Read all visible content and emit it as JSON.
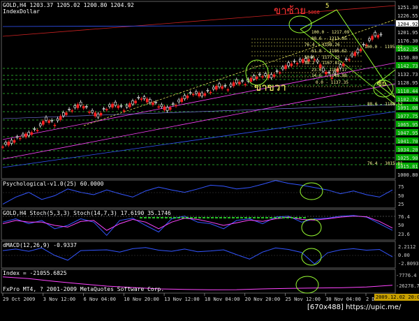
{
  "window": {
    "title": "GOLD,H4  1203.37 1205.02 1200.80 1204.92",
    "subtitle": "IndexDollar"
  },
  "annotations": {
    "thai_top": "ขาซ้าย",
    "thai_bottom": "ขาขวา",
    "wave_top": "5",
    "wave_mid": "ซ้ย",
    "level_5060": "5060",
    "watermark": "[670x488] https://upic.me/",
    "copyright": "FxPro MT4, ? 2001-2009 MetaQuotes Software Corp.",
    "time_stamp": "2009.12.02 20:00"
  },
  "fib_labels": [
    "100.0 - 1217.09",
    "88.6 - 1213.95",
    "76.4 - 1198.26",
    "61.8 - 1186.62",
    "50.0 - 1177.25",
    "38.2 - 1167.81",
    "23.6 - 1156.17",
    "14.6 - 1148.98",
    "0.0 - 1137.35",
    "100.0 - 1195.22",
    "88.6 - 1188.52",
    "76.4 - 1015.81"
  ],
  "price_axis": {
    "labels": [
      "1251.30",
      "1226.55",
      "1204.92",
      "1201.95",
      "1176.30",
      "1162.35",
      "1150.80",
      "1142.73",
      "1132.73",
      "1128.95",
      "1118.44",
      "1102.74",
      "1091.08",
      "1077.75",
      "1065.95",
      "1047.95",
      "1041.70",
      "1034.20",
      "1025.90",
      "1015.81",
      "1000.80"
    ],
    "highlight_labels": [
      "1162.35",
      "1142.73",
      "1118.44",
      "1102.74",
      "1091.08",
      "1077.75",
      "1065.95",
      "1047.95",
      "1041.70",
      "1034.20",
      "1025.90",
      "1015.81"
    ],
    "current_label": "1204.92"
  },
  "time_axis": {
    "labels": [
      "29 Oct 2009",
      "3 Nov 12:00",
      "6 Nov 04:00",
      "10 Nov 20:00",
      "13 Nov 12:00",
      "18 Nov 04:00",
      "20 Nov 20:00",
      "25 Nov 12:00",
      "30 Nov 04:00",
      "2 Dec 20:00"
    ]
  },
  "indicators": {
    "psychological": {
      "title": "Psychological-v1.0(25) 60.0000",
      "axis": [
        "75",
        "50",
        "25"
      ]
    },
    "stoch": {
      "title": "GOLD,H4 Stoch(5,3,3) Stoch(14,7,3) 17.6190 35.1746",
      "axis": [
        "76.4",
        "50",
        "23.6"
      ]
    },
    "macd": {
      "title": "dMACD(12,26,9) -0.9337",
      "axis": [
        "2.2112",
        "0.00",
        "-2.8093"
      ]
    },
    "index": {
      "title": "Index = -21055.6825",
      "axis": [
        "-7776.4",
        "-26278.7"
      ]
    }
  },
  "colors": {
    "background": "#000000",
    "bull": "#ffffff",
    "bear": "#ff2020",
    "fib": "#ffff66",
    "grid_green": "#33cc33",
    "channel": "#ff44ff",
    "blue_line": "#3355ff",
    "axis_box": "#00aa00"
  },
  "chart_data": [
    {
      "type": "line",
      "series": [
        {
          "x": [
            0,
            10,
            20,
            30,
            40,
            50,
            60,
            70,
            80,
            90,
            100,
            110,
            120,
            130,
            140,
            150,
            160,
            170,
            180,
            190,
            200,
            210,
            220,
            230,
            240,
            250,
            260,
            270,
            280,
            290,
            300,
            310,
            320,
            330,
            340,
            350,
            360,
            370,
            380,
            390,
            400,
            410,
            420,
            430,
            440
          ],
          "values": [
            1045,
            1050,
            1058,
            1062,
            1070,
            1085,
            1078,
            1092,
            1100,
            1108,
            1098,
            1090,
            1102,
            1108,
            1100,
            1110,
            1118,
            1112,
            1106,
            1100,
            1108,
            1118,
            1125,
            1122,
            1128,
            1136,
            1132,
            1142,
            1140,
            1148,
            1152,
            1150,
            1158,
            1168,
            1172,
            1175,
            1178,
            1160,
            1150,
            1165,
            1178,
            1188,
            1200,
            1214,
            1210
          ]
        }
      ],
      "ylim": [
        1000.8,
        1260
      ]
    },
    {
      "type": "line",
      "series": [
        {
          "x": [
            0,
            15,
            30,
            45,
            60,
            75,
            90,
            105,
            120,
            135,
            150,
            165,
            180,
            195,
            210,
            225,
            240,
            255,
            270,
            285,
            300,
            315,
            330,
            345,
            360,
            375,
            390,
            405,
            420,
            435,
            450
          ],
          "values": [
            30,
            45,
            55,
            40,
            48,
            62,
            55,
            50,
            60,
            52,
            45,
            58,
            66,
            60,
            55,
            62,
            70,
            68,
            62,
            65,
            72,
            80,
            74,
            70,
            65,
            60,
            52,
            58,
            50,
            45,
            60
          ]
        }
      ],
      "ylim": [
        25,
        75
      ]
    },
    {
      "type": "line",
      "series": [
        {
          "x": [
            0,
            15,
            30,
            45,
            60,
            75,
            90,
            105,
            120,
            135,
            150,
            165,
            180,
            195,
            210,
            225,
            240,
            255,
            270,
            285,
            300,
            315,
            330,
            345,
            360,
            375,
            390,
            405,
            420,
            435,
            450
          ],
          "values": [
            60,
            70,
            55,
            65,
            40,
            50,
            70,
            60,
            20,
            65,
            72,
            50,
            30,
            70,
            78,
            60,
            55,
            40,
            65,
            70,
            55,
            75,
            78,
            60,
            70,
            72,
            78,
            80,
            75,
            55,
            35
          ]
        },
        {
          "x": [
            0,
            15,
            30,
            45,
            60,
            75,
            90,
            105,
            120,
            135,
            150,
            165,
            180,
            195,
            210,
            225,
            240,
            255,
            270,
            285,
            300,
            315,
            330,
            345,
            360,
            375,
            390,
            405,
            420,
            435,
            450
          ],
          "values": [
            55,
            65,
            60,
            60,
            50,
            45,
            62,
            65,
            35,
            55,
            68,
            60,
            40,
            60,
            72,
            68,
            60,
            50,
            58,
            66,
            62,
            70,
            75,
            68,
            66,
            70,
            75,
            78,
            76,
            62,
            42
          ]
        }
      ],
      "ylim": [
        10,
        90
      ]
    },
    {
      "type": "line",
      "series": [
        {
          "x": [
            0,
            15,
            30,
            45,
            60,
            75,
            90,
            105,
            120,
            135,
            150,
            165,
            180,
            195,
            210,
            225,
            240,
            255,
            270,
            285,
            300,
            315,
            330,
            345,
            360,
            375,
            390,
            405,
            420,
            435,
            450
          ],
          "values": [
            0.8,
            1.2,
            0.6,
            1.5,
            -0.5,
            -1.8,
            0.8,
            0.9,
            1.0,
            0.4,
            1.3,
            1.6,
            0.9,
            0.6,
            1.2,
            0.5,
            0.7,
            1.0,
            -0.3,
            -1.5,
            0.4,
            1.5,
            1.1,
            0.3,
            -2.8,
            0.2,
            1.0,
            1.3,
            0.9,
            1.1,
            -0.9
          ]
        }
      ],
      "ylim": [
        -3.5,
        2.5
      ]
    },
    {
      "type": "line",
      "series": [
        {
          "x": [
            0,
            30,
            60,
            90,
            120,
            150,
            180,
            210,
            240,
            270,
            300,
            330,
            360,
            390,
            420,
            450
          ],
          "values": [
            -12000,
            -14000,
            -17000,
            -19500,
            -22000,
            -23500,
            -25000,
            -25500,
            -26000,
            -25800,
            -25000,
            -24500,
            -24000,
            -23800,
            -23000,
            -21055
          ]
        }
      ],
      "ylim": [
        -28000,
        -7000
      ]
    }
  ]
}
